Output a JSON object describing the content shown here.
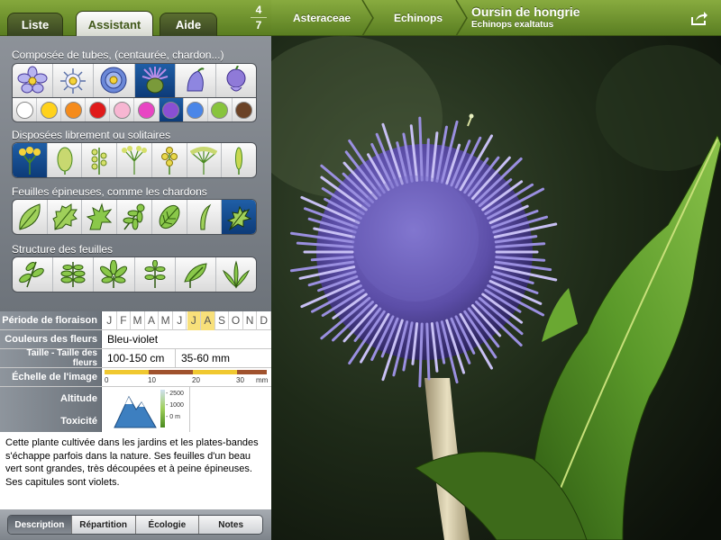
{
  "tabs": [
    {
      "label": "Liste"
    },
    {
      "label": "Assistant"
    },
    {
      "label": "Aide"
    }
  ],
  "counter": {
    "current": "4",
    "total": "7"
  },
  "assistant": {
    "section1_label": "Composée de tubes, (centaurée, chardon...)",
    "flower_icons": [
      "daisy-blue-icon",
      "daisy-white-icon",
      "aster-blue-icon",
      "thistle-icon",
      "bellflower-icon",
      "clover-head-icon"
    ],
    "colors": [
      "#ffffff",
      "#ffd21c",
      "#f58b1b",
      "#e01a1a",
      "#f7b6d2",
      "#e845c3",
      "#8a4fd3",
      "#4a86e8",
      "#88c43d",
      "#6b4226"
    ],
    "selected_color_index": 6,
    "section2_label": "Disposées librement ou solitaires",
    "section3_label": "Feuilles épineuses, comme les chardons",
    "section4_label": "Structure des feuilles"
  },
  "table": {
    "flowering_label": "Période de floraison",
    "months": [
      "J",
      "F",
      "M",
      "A",
      "M",
      "J",
      "J",
      "A",
      "S",
      "O",
      "N",
      "D"
    ],
    "flowering_months": [
      6,
      7
    ],
    "colors_label": "Couleurs des fleurs",
    "colors_value": "Bleu-violet",
    "size_label": "Taille - Taille des fleurs",
    "size_value": "100-150 cm",
    "flower_size_value": "35-60 mm",
    "scale_label": "Échelle de l'image",
    "scale_ticks": [
      "0",
      "10",
      "20",
      "30",
      "mm"
    ],
    "altitude_label": "Altitude",
    "toxicity_label": "Toxicité",
    "altitude_marks": [
      "2500",
      "1000",
      "0 m"
    ]
  },
  "description": "Cette plante cultivée dans les jardins et les plates-bandes s'échappe parfois dans la nature. Ses feuilles d'un beau vert sont grandes, très découpées et à peine épineuses. Ses capitules sont violets.",
  "bottom_tabs": [
    {
      "label": "Description"
    },
    {
      "label": "Répartition"
    },
    {
      "label": "Écologie"
    },
    {
      "label": "Notes"
    }
  ],
  "active_bottom_tab": 0,
  "header": {
    "family": "Asteraceae",
    "genus": "Echinops",
    "common_name": "Oursin de hongrie",
    "latin_name": "Echinops exaltatus"
  }
}
